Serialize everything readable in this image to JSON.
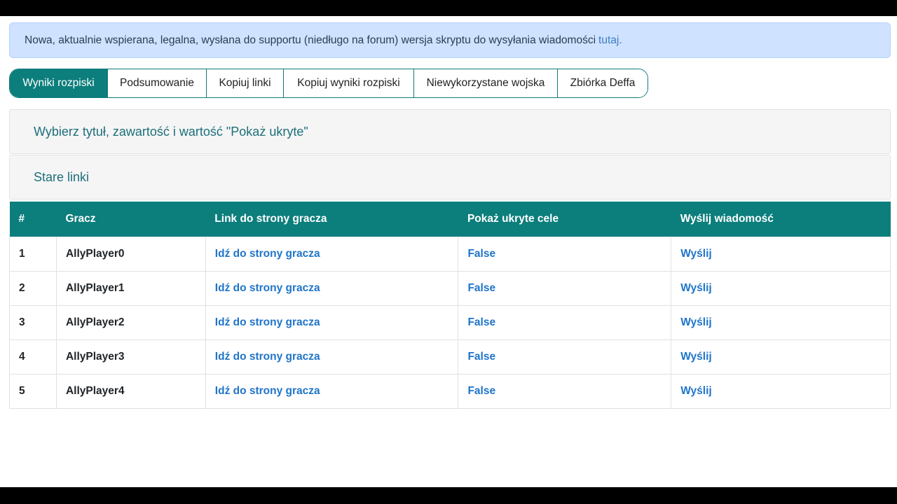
{
  "alert": {
    "text": "Nowa, aktualnie wspierana, legalna, wysłana do supportu (niedługo na forum) wersja skryptu do wysyłania wiadomości",
    "link_label": "tutaj."
  },
  "tabs": [
    {
      "label": "Wyniki rozpiski",
      "active": true
    },
    {
      "label": "Podsumowanie",
      "active": false
    },
    {
      "label": "Kopiuj linki",
      "active": false
    },
    {
      "label": "Kopiuj wyniki rozpiski",
      "active": false
    },
    {
      "label": "Niewykorzystane wojska",
      "active": false
    },
    {
      "label": "Zbiórka Deffa",
      "active": false
    }
  ],
  "panels": {
    "options_title": "Wybierz tytuł, zawartość i wartość \"Pokaż ukryte\"",
    "old_links_title": "Stare linki"
  },
  "table": {
    "headers": [
      "#",
      "Gracz",
      "Link do strony gracza",
      "Pokaż ukryte cele",
      "Wyślij wiadomość"
    ],
    "rows": [
      {
        "num": "1",
        "player": "AllyPlayer0",
        "link": "Idź do strony gracza",
        "hidden": "False",
        "send": "Wyślij"
      },
      {
        "num": "2",
        "player": "AllyPlayer1",
        "link": "Idź do strony gracza",
        "hidden": "False",
        "send": "Wyślij"
      },
      {
        "num": "3",
        "player": "AllyPlayer2",
        "link": "Idź do strony gracza",
        "hidden": "False",
        "send": "Wyślij"
      },
      {
        "num": "4",
        "player": "AllyPlayer3",
        "link": "Idź do strony gracza",
        "hidden": "False",
        "send": "Wyślij"
      },
      {
        "num": "5",
        "player": "AllyPlayer4",
        "link": "Idź do strony gracza",
        "hidden": "False",
        "send": "Wyślij"
      }
    ]
  },
  "colors": {
    "accent": "#0c7e7c",
    "link": "#1f74c9",
    "alert_bg": "#cfe2ff",
    "panel_title": "#1d6f7a"
  }
}
